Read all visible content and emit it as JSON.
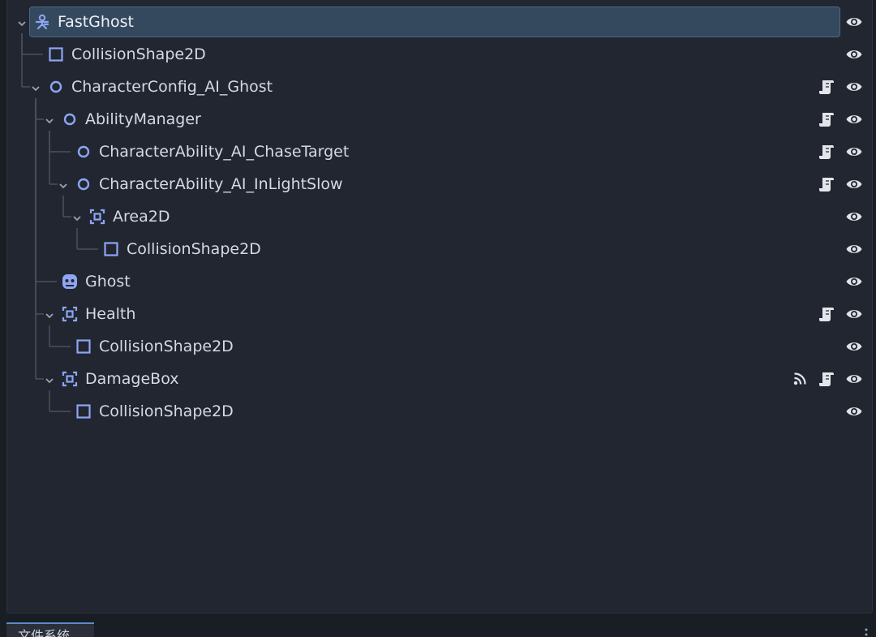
{
  "nodes": [
    {
      "label": "FastGhost",
      "depth": 0,
      "icon": "character-body-icon",
      "expanded": true,
      "script": false,
      "signal": false,
      "selected": true
    },
    {
      "label": "CollisionShape2D",
      "depth": 1,
      "icon": "collision-shape-icon",
      "expanded": null,
      "script": false,
      "signal": false
    },
    {
      "label": "CharacterConfig_AI_Ghost",
      "depth": 1,
      "icon": "node-circle-icon",
      "expanded": true,
      "script": true,
      "signal": false
    },
    {
      "label": "AbilityManager",
      "depth": 2,
      "icon": "node-circle-icon",
      "expanded": true,
      "script": true,
      "signal": false
    },
    {
      "label": "CharacterAbility_AI_ChaseTarget",
      "depth": 3,
      "icon": "node-circle-icon",
      "expanded": null,
      "script": true,
      "signal": false
    },
    {
      "label": "CharacterAbility_AI_InLightSlow",
      "depth": 3,
      "icon": "node-circle-icon",
      "expanded": true,
      "script": true,
      "signal": false
    },
    {
      "label": "Area2D",
      "depth": 4,
      "icon": "area2d-icon",
      "expanded": true,
      "script": false,
      "signal": false
    },
    {
      "label": "CollisionShape2D",
      "depth": 5,
      "icon": "collision-shape-icon",
      "expanded": null,
      "script": false,
      "signal": false
    },
    {
      "label": "Ghost",
      "depth": 2,
      "icon": "sprite-ghost-icon",
      "expanded": null,
      "script": false,
      "signal": false
    },
    {
      "label": "Health",
      "depth": 2,
      "icon": "area2d-icon",
      "expanded": true,
      "script": true,
      "signal": false
    },
    {
      "label": "CollisionShape2D",
      "depth": 3,
      "icon": "collision-shape-icon",
      "expanded": null,
      "script": false,
      "signal": false
    },
    {
      "label": "DamageBox",
      "depth": 2,
      "icon": "area2d-icon",
      "expanded": true,
      "script": true,
      "signal": true
    },
    {
      "label": "CollisionShape2D",
      "depth": 3,
      "icon": "collision-shape-icon",
      "expanded": null,
      "script": false,
      "signal": false
    }
  ],
  "bottom_tab": {
    "label": "文件系统"
  },
  "colors": {
    "icon_blue": "#8da5f3",
    "selected_bg": "#35495e",
    "panel_bg": "#222630",
    "text": "#d5dae2",
    "tree_line": "#4a505c",
    "eye": "#e0e4ea"
  }
}
